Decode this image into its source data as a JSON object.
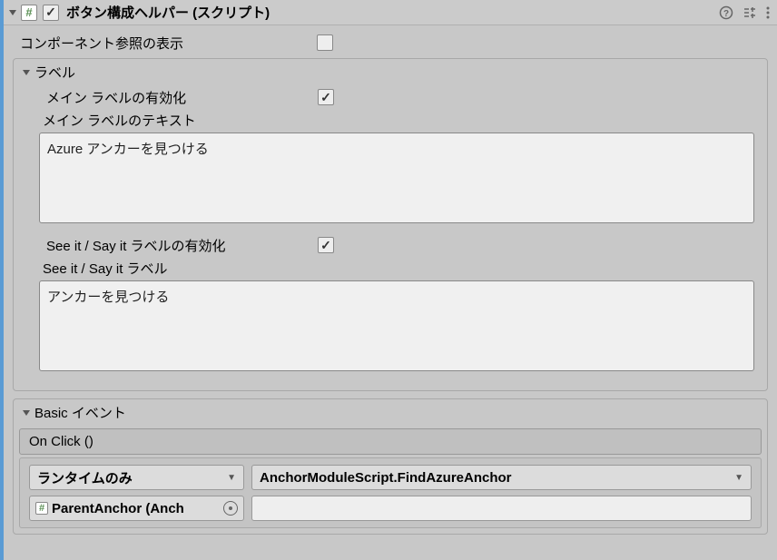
{
  "header": {
    "title": "ボタン構成ヘルパー (スクリプト)",
    "enabled": true
  },
  "componentRefs": {
    "label": "コンポーネント参照の表示",
    "checked": false
  },
  "labelsSection": {
    "title": "ラベル",
    "mainLabelEnable": {
      "label": "メイン ラベルの有効化",
      "checked": true
    },
    "mainLabelText": {
      "label": "メイン ラベルのテキスト",
      "value": "Azure アンカーを見つける"
    },
    "seeItSayItEnable": {
      "label": "See it / Say it ラベルの有効化",
      "checked": true
    },
    "seeItSayItLabel": {
      "label": "See it / Say it ラベル",
      "value": "アンカーを見つける"
    }
  },
  "basicEvents": {
    "title": "Basic イベント",
    "onClick": {
      "title": "On Click ()",
      "runtime": "ランタイムのみ",
      "function": "AnchorModuleScript.FindAzureAnchor",
      "target": "ParentAnchor (Anch",
      "arg": ""
    }
  }
}
